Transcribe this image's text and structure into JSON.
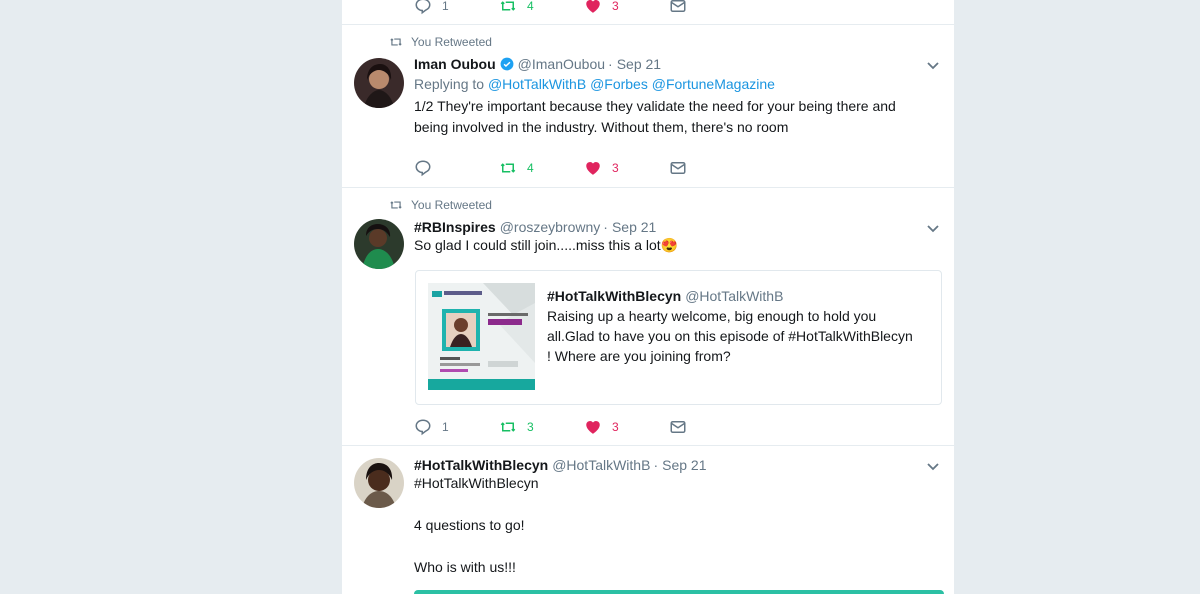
{
  "top_tweet_actions": {
    "reply_count": "1",
    "retweet_count": "4",
    "like_count": "3"
  },
  "tweets": [
    {
      "context": "You Retweeted",
      "name": "Iman Oubou",
      "verified": true,
      "handle": "@ImanOubou",
      "time": "Sep 21",
      "replying_label": "Replying to",
      "replying_to": [
        "@HotTalkWithB",
        "@Forbes",
        "@FortuneMagazine"
      ],
      "text_lines": [
        "1/2 They're important because they validate the need for your being there and",
        "being involved in the industry. Without them, there's no room"
      ],
      "reply_count": "",
      "retweet_count": "4",
      "like_count": "3"
    },
    {
      "context": "You Retweeted",
      "name": "#RBInspires",
      "handle": "@roszeybrowny",
      "time": "Sep 21",
      "text": "So glad I could still join.....miss this a lot",
      "emoji": "😍",
      "quote": {
        "name": "#HotTalkWithBlecyn",
        "handle": "@HotTalkWithB",
        "text_lines": [
          "Raising up a hearty welcome, big enough to hold you",
          "all.Glad to have you on this episode of #HotTalkWithBlecyn",
          "! Where are you joining from?"
        ]
      },
      "reply_count": "1",
      "retweet_count": "3",
      "like_count": "3"
    },
    {
      "name": "#HotTalkWithBlecyn",
      "handle": "@HotTalkWithB",
      "time": "Sep 21",
      "hashtag": "#HotTalkWithBlecyn",
      "line1": "4 questions to go!",
      "line2": "Who is with us!!!"
    }
  ],
  "separator": "·",
  "colors": {
    "link": "#1b95e0",
    "retweet": "#17bf63",
    "like": "#e0245e",
    "muted": "#657786",
    "page_bg": "#e6ecf0",
    "media_accent": "#2bc0a4"
  },
  "icons": [
    "retweet-icon",
    "verified-icon",
    "chevron-down-icon",
    "reply-icon",
    "heart-icon",
    "message-icon"
  ]
}
